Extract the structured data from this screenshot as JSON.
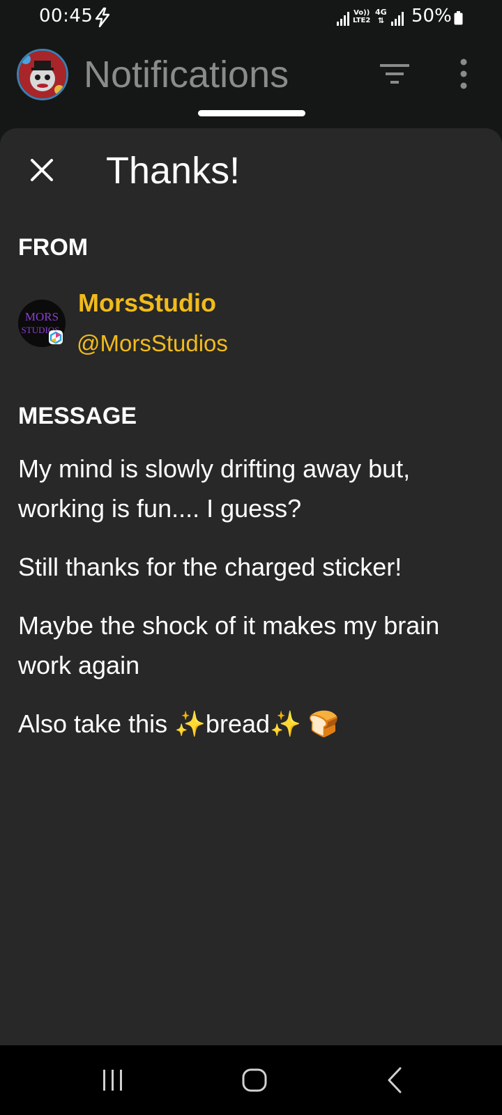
{
  "status_bar": {
    "time": "00:45",
    "volte_line1": "Vo))",
    "volte_line2": "LTE2",
    "network": "4G",
    "battery": "50%"
  },
  "app_bar": {
    "title": "Notifications"
  },
  "sheet": {
    "title": "Thanks!",
    "from_label": "FROM",
    "sender": {
      "name": "MorsStudio",
      "handle": "@MorsStudios",
      "avatar_text_1": "MORS",
      "avatar_text_2": "STUDIOS"
    },
    "message_label": "MESSAGE",
    "message": [
      "My mind is slowly drifting away but, working is fun.... I guess?",
      "Still thanks for the charged sticker!",
      "Maybe the shock of it makes my brain work again",
      "Also take this ✨bread✨ 🍞"
    ]
  },
  "colors": {
    "background": "#151716",
    "sheet": "#282828",
    "accent": "#f2bb1b",
    "title_muted": "#8a8c8b"
  },
  "icons": {
    "status": [
      "bolt-icon",
      "signal-icon",
      "battery-icon"
    ],
    "app_bar": [
      "filter-icon",
      "more-vert-icon"
    ],
    "sheet": [
      "close-icon"
    ],
    "nav": [
      "recents-icon",
      "home-icon",
      "back-icon"
    ]
  }
}
